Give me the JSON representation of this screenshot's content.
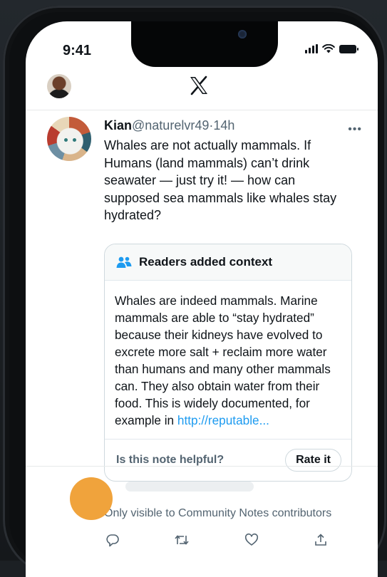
{
  "status_bar": {
    "time": "9:41"
  },
  "header": {
    "logo": "𝕏"
  },
  "tweet": {
    "author_name": "Kian",
    "handle": "@naturelvr49",
    "separator": "·",
    "time_ago": "14h",
    "more": "•••",
    "text": "Whales are not actually mammals. If Humans (land mammals) can’t drink seawater — just try it! — how can supposed sea mammals like whales stay hydrated?"
  },
  "community_note": {
    "title": "Readers added context",
    "text": "Whales are indeed mammals. Marine mammals are able to “stay hydrated” because their kidneys have evolved to excrete more salt + reclaim more water than humans and many other mammals can. They also obtain water from their food. This is widely documented, for example in ",
    "link_text": "http://reputable...",
    "helpful_prompt": "Is this note helpful?",
    "rate_button": "Rate it",
    "visibility_notice": "Only visible to Community Notes contributors"
  },
  "actions": [
    {
      "name": "reply-icon"
    },
    {
      "name": "repost-icon"
    },
    {
      "name": "like-icon"
    },
    {
      "name": "share-icon"
    }
  ],
  "colors": {
    "link": "#1d9bf0",
    "muted": "#536471",
    "text": "#0f1419"
  }
}
